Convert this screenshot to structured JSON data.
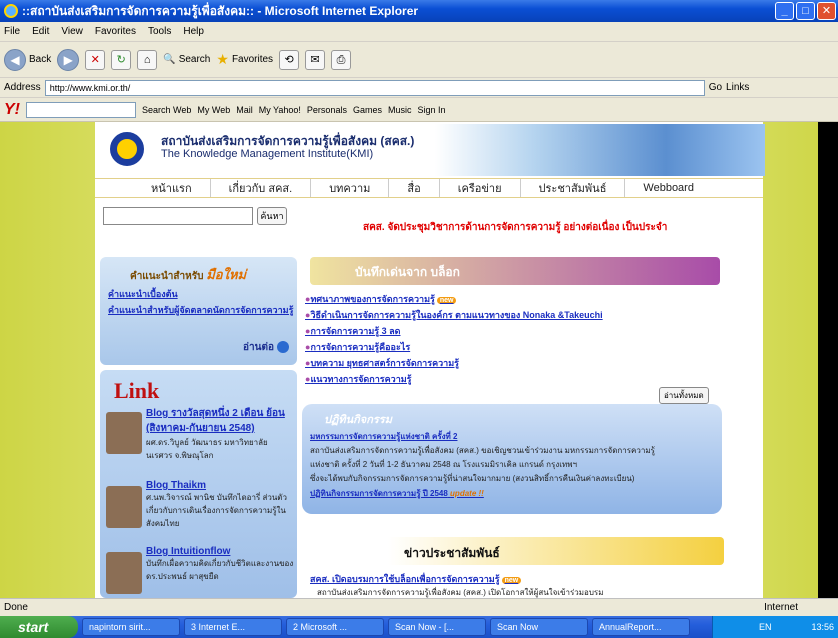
{
  "window": {
    "title": "::สถาบันส่งเสริมการจัดการความรู้เพื่อสังคม:: - Microsoft Internet Explorer"
  },
  "menu": [
    "File",
    "Edit",
    "View",
    "Favorites",
    "Tools",
    "Help"
  ],
  "toolbar": {
    "back": "Back",
    "search": "Search",
    "favorites": "Favorites"
  },
  "address": {
    "label": "Address",
    "url": "http://www.kmi.or.th/",
    "go": "Go",
    "links": "Links"
  },
  "yahoo": {
    "search_web": "Search Web",
    "my_web": "My Web",
    "mail": "Mail",
    "my_yahoo": "My Yahoo!",
    "personals": "Personals",
    "games": "Games",
    "music": "Music",
    "sign_in": "Sign In"
  },
  "site": {
    "org_th": "สถาบันส่งเสริมการจัดการความรู้เพื่อสังคม (สคส.)",
    "org_en": "The Knowledge Management Institute(KMI)",
    "nav": [
      "หน้าแรก",
      "เกี่ยวกับ สคส.",
      "บทความ",
      "สื่อ",
      "เครือข่าย",
      "ประชาสัมพันธ์",
      "Webboard"
    ],
    "search_btn": "ค้นหา",
    "marquee": "สคส. จัดประชุมวิชาการด้านการจัดการความรู้ อย่างต่อเนื่อง เป็นประจำ",
    "left_box": {
      "title": "คำแนะนำสำหรับ",
      "title_em": "มือใหม่",
      "links": [
        "คำแนะนำเบื้องต้น",
        "คำแนะนำสำหรับผู้จัดตลาดนัดการจัดการความรู้"
      ],
      "read_more": "อ่านต่อ"
    },
    "link_heading": "Link",
    "blogs_left": [
      {
        "title": "Blog รางวัลสุดหนึ่ง 2 เดือน ย้อน (สิงหาคม-กันยายน 2548)",
        "desc": "ผศ.ดร.วิบูลย์ วัฒนาธร มหาวิทยาลัยนเรศวร จ.พิษณุโลก"
      },
      {
        "title": "Blog Thaikm",
        "desc": "ศ.นพ.วิจารณ์ พานิช บันทึกไดอารี่ ส่วนตัวเกี่ยวกับการเดินเรื่องการจัดการความรู้ในสังคมไทย"
      },
      {
        "title": "Blog Intuitionflow",
        "desc": "บันทึกเผื่อความคิดเกี่ยวกับชีวิตและงานของ ดร.ประพนธ์ ผาสุขยืด"
      }
    ],
    "blog_header": "บันทึกเด่นจาก บล็อก",
    "blog_list": [
      "ทศนาภาพของการจัดการความรู้",
      "วิธีดำเนินการจัดการความรู้ในองค์กร ตามแนวทางของ Nonaka &Takeuchi",
      "การจัดการความรู้ 3 ลด",
      "การจัดการความรู้คืออะไร",
      "บทความ ยุทธศาสตร์การจัดการความรู้",
      "แนวทางการจัดการความรู้"
    ],
    "new_badge": "new",
    "all_btn": "อ่านทั้งหมด",
    "event": {
      "heading": "ปฏิทินกิจกรรม",
      "title": "มหกรรมการจัดการความรู้แห่งชาติ ครั้งที่ 2",
      "p1": "สถาบันส่งเสริมการจัดการความรู้เพื่อสังคม (สคส.) ขอเชิญชวนเข้าร่วมงาน มหกรรมการจัดการความรู้",
      "p2": "แห่งชาติ ครั้งที่ 2 วันที่ 1-2 ธันวาคม 2548 ณ โรงแรมมิราเคิล แกรนด์ กรุงเทพฯ",
      "p3": "ซึ่งจะได้พบกับกิจกรรมการจัดการความรู้ที่น่าสนใจมากมาย (สงวนสิทธิ์การคืนเงินค่าลงทะเบียน)",
      "cal": "ปฏิทินกิจกรรมการจัดการความรู้ ปี 2548",
      "update": "update !!"
    },
    "pr_header": "ข่าวประชาสัมพันธ์",
    "pr1": "สคส. เปิดอบรมการใช้บล็อกเพื่อการจัดการความรู้",
    "pr2": "สถาบันส่งเสริมการจัดการความรู้เพื่อสังคม (สคส.) เปิดโอกาสให้ผู้สนใจเข้าร่วมอบรม"
  },
  "status": {
    "text": "Done",
    "zone": "Internet"
  },
  "taskbar": {
    "start": "start",
    "items": [
      "napintorn sirit...",
      "3 Internet E...",
      "2 Microsoft ...",
      "Scan Now - [...",
      "Scan Now",
      "AnnualReport..."
    ],
    "lang": "EN",
    "time": "13:56"
  }
}
